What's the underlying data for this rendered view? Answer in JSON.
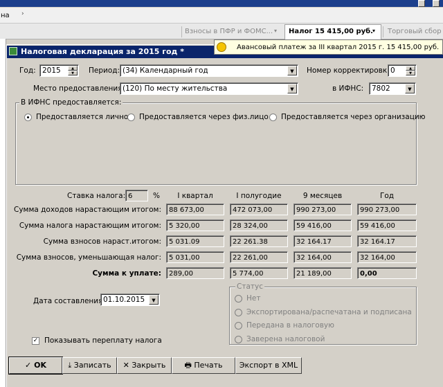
{
  "background_app": {
    "menu_fragment": "на",
    "tabs": [
      {
        "label": "Взносы в ПФР и ФОМС..."
      },
      {
        "label": "Налог 15 415,00 руб."
      },
      {
        "label": "Торговый сбор"
      }
    ],
    "tooltip": "Авансовый платеж за III квартал 2015 г. 15 415,00 руб."
  },
  "dialog": {
    "title": "Налоговая декларация за 2015 год *",
    "year_label": "Год:",
    "year_value": "2015",
    "period_label": "Период:",
    "period_value": "(34) Календарный год",
    "correction_label": "Номер корректировки:",
    "correction_value": "0",
    "place_label": "Место предоставления:",
    "place_value": "(120) По месту жительства",
    "ifns_label": "в ИФНС:",
    "ifns_value": "7802",
    "submission": {
      "group_title": "В ИФНС предоставляется:",
      "options": [
        {
          "label": "Предоставляется лично",
          "selected": true
        },
        {
          "label": "Предоставляется через физ.лицо",
          "selected": false
        },
        {
          "label": "Предоставляется через организацию",
          "selected": false
        }
      ]
    },
    "tax_rate_label": "Ставка налога:",
    "tax_rate_value": "6",
    "tax_rate_unit": "%",
    "columns": [
      "I квартал",
      "I полугодие",
      "9 месяцев",
      "Год"
    ],
    "rows": [
      {
        "label": "Сумма доходов нарастающим итогом:",
        "values": [
          "88 673,00",
          "472 073,00",
          "990 273,00",
          "990 273,00"
        ]
      },
      {
        "label": "Сумма налога нарастающим итогом:",
        "values": [
          "5 320,00",
          "28 324,00",
          "59 416,00",
          "59 416,00"
        ]
      },
      {
        "label": "Сумма взносов нараст.итогом:",
        "values": [
          "5 031.09",
          "22 261.38",
          "32 164.17",
          "32 164.17"
        ]
      },
      {
        "label": "Сумма взносов, уменьшающая налог:",
        "values": [
          "5 031,00",
          "22 261,00",
          "32 164,00",
          "32 164,00"
        ]
      }
    ],
    "payment_row": {
      "label": "Сумма к уплате:",
      "values": [
        "289,00",
        "5 774,00",
        "21 189,00",
        "0,00"
      ]
    },
    "date_label": "Дата составления:",
    "date_value": "01.10.2015",
    "show_overpayment_label": "Показывать переплату налога",
    "show_overpayment_checked": true,
    "status": {
      "group_title": "Статус",
      "options": [
        "Нет",
        "Экспортирована/распечатана и подписана",
        "Передана в налоговую",
        "Заверена налоговой"
      ]
    },
    "buttons": {
      "ok": "OK",
      "save": "Записать",
      "close": "Закрыть",
      "print": "Печать",
      "export": "Экспорт в XML"
    }
  }
}
